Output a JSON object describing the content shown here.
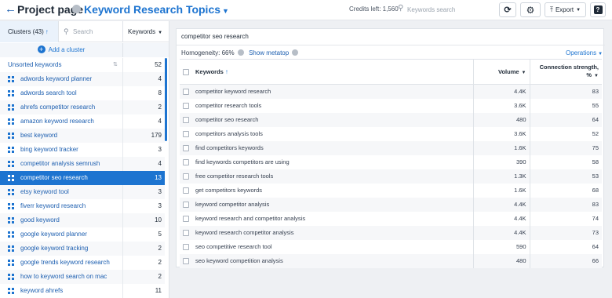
{
  "header": {
    "back_icon": "arrow-left-icon",
    "title": "Project page",
    "project_name": "Keyword Research Topics",
    "credits": "Credits left: 1,560",
    "search_placeholder": "Keywords search",
    "export_label": "Export",
    "help_label": "?"
  },
  "sidebar": {
    "clusters_tab": "Clusters (43)",
    "search_placeholder": "Search",
    "keywords_col": "Keywords",
    "add_cluster": "Add a cluster",
    "items": [
      {
        "label": "Unsorted keywords",
        "count": "52",
        "icon": false
      },
      {
        "label": "adwords keyword planner",
        "count": "4",
        "icon": true
      },
      {
        "label": "adwords search tool",
        "count": "8",
        "icon": true
      },
      {
        "label": "ahrefs competitor research",
        "count": "2",
        "icon": true
      },
      {
        "label": "amazon keyword research",
        "count": "4",
        "icon": true
      },
      {
        "label": "best keyword",
        "count": "179",
        "icon": true
      },
      {
        "label": "bing keyword tracker",
        "count": "3",
        "icon": true
      },
      {
        "label": "competitor analysis semrush",
        "count": "4",
        "icon": true
      },
      {
        "label": "competitor seo research",
        "count": "13",
        "icon": true,
        "selected": true
      },
      {
        "label": "etsy keyword tool",
        "count": "3",
        "icon": true
      },
      {
        "label": "fiverr keyword research",
        "count": "3",
        "icon": true
      },
      {
        "label": "good keyword",
        "count": "10",
        "icon": true
      },
      {
        "label": "google keyword planner",
        "count": "5",
        "icon": true
      },
      {
        "label": "google keyword tracking",
        "count": "2",
        "icon": true
      },
      {
        "label": "google trends keyword research",
        "count": "2",
        "icon": true
      },
      {
        "label": "how to keyword search on mac",
        "count": "2",
        "icon": true
      },
      {
        "label": "keyword ahrefs",
        "count": "11",
        "icon": true
      }
    ]
  },
  "main": {
    "cluster_title": "competitor seo research",
    "homogeneity": "Homogeneity: 66%",
    "show_metatop": "Show metatop",
    "operations": "Operations",
    "columns": {
      "keywords": "Keywords",
      "volume": "Volume",
      "strength": "Connection strength, %"
    },
    "rows": [
      {
        "keyword": "competitor keyword research",
        "volume": "4.4K",
        "strength": "83"
      },
      {
        "keyword": "competitor research tools",
        "volume": "3.6K",
        "strength": "55"
      },
      {
        "keyword": "competitor seo research",
        "volume": "480",
        "strength": "64"
      },
      {
        "keyword": "competitors analysis tools",
        "volume": "3.6K",
        "strength": "52"
      },
      {
        "keyword": "find competitors keywords",
        "volume": "1.6K",
        "strength": "75"
      },
      {
        "keyword": "find keywords competitors are using",
        "volume": "390",
        "strength": "58"
      },
      {
        "keyword": "free competitor research tools",
        "volume": "1.3K",
        "strength": "53"
      },
      {
        "keyword": "get competitors keywords",
        "volume": "1.6K",
        "strength": "68"
      },
      {
        "keyword": "keyword competitor analysis",
        "volume": "4.4K",
        "strength": "83"
      },
      {
        "keyword": "keyword research and competitor analysis",
        "volume": "4.4K",
        "strength": "74"
      },
      {
        "keyword": "keyword research competitor analysis",
        "volume": "4.4K",
        "strength": "73"
      },
      {
        "keyword": "seo competitive research tool",
        "volume": "590",
        "strength": "64"
      },
      {
        "keyword": "seo keyword competition analysis",
        "volume": "480",
        "strength": "66"
      }
    ]
  },
  "colors": {
    "accent": "#1d74d0",
    "selected_row": "#1d74d0"
  }
}
